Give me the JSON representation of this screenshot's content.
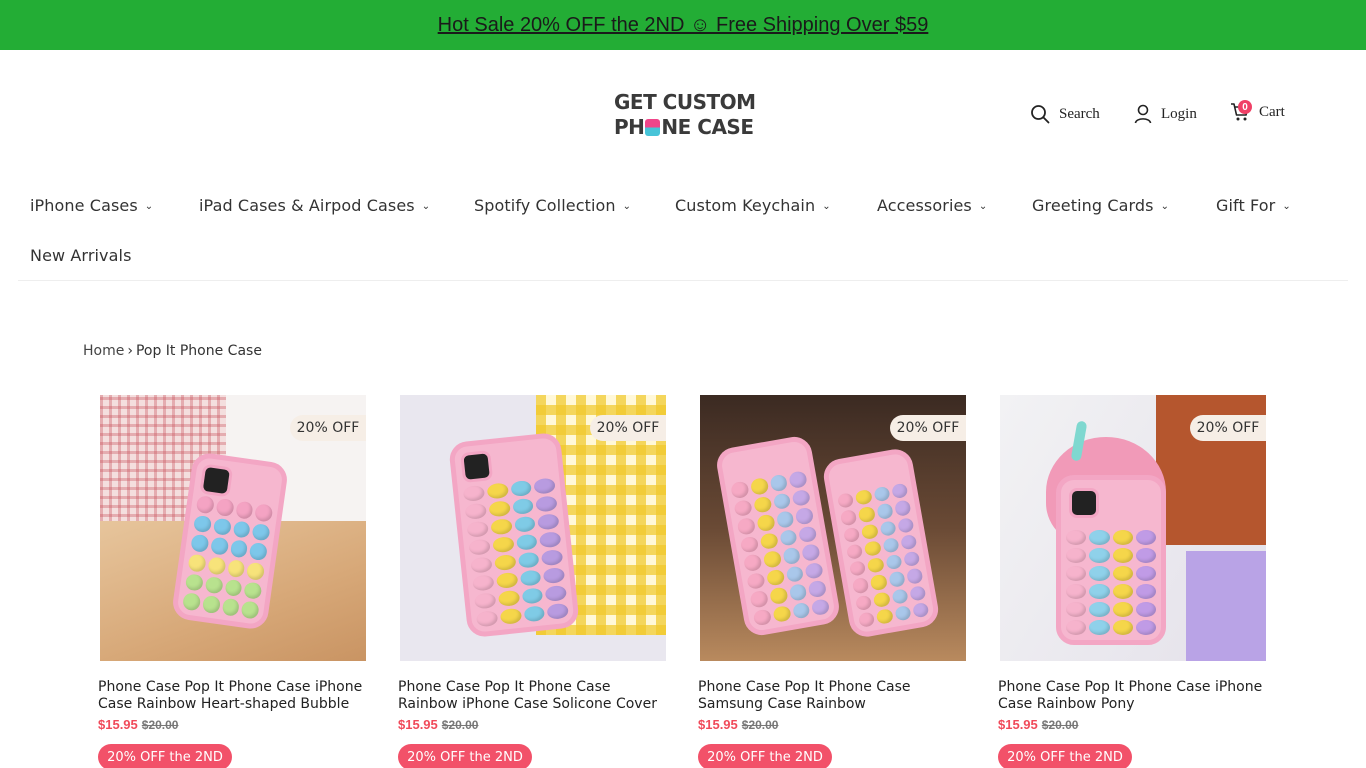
{
  "announcement": {
    "text": "Hot Sale 20% OFF the 2ND ☺ Free Shipping Over $59"
  },
  "logo": {
    "line1": "GET CUSTOM",
    "line2_a": "PH",
    "line2_b": "NE CASE"
  },
  "header": {
    "search_label": "Search",
    "login_label": "Login",
    "cart_label": "Cart",
    "cart_count": "0"
  },
  "nav": {
    "items": [
      {
        "label": "iPhone Cases",
        "has_dropdown": true
      },
      {
        "label": "iPad Cases & Airpod Cases",
        "has_dropdown": true
      },
      {
        "label": "Spotify Collection",
        "has_dropdown": true
      },
      {
        "label": "Custom Keychain",
        "has_dropdown": true
      },
      {
        "label": "Accessories",
        "has_dropdown": true
      },
      {
        "label": "Greeting Cards",
        "has_dropdown": true
      },
      {
        "label": "Gift For",
        "has_dropdown": true
      },
      {
        "label": "New Arrivals",
        "has_dropdown": false
      }
    ]
  },
  "breadcrumb": {
    "home": "Home",
    "separator": "›",
    "current": "Pop It Phone Case"
  },
  "products": [
    {
      "title": "Phone Case Pop It Phone Case iPhone Case Rainbow Heart-shaped Bubble",
      "price": "$15.95",
      "compare_price": "$20.00",
      "badge": "20% OFF",
      "promo": "20% OFF the 2ND"
    },
    {
      "title": "Phone Case Pop It Phone Case Rainbow iPhone Case Solicone Cover",
      "price": "$15.95",
      "compare_price": "$20.00",
      "badge": "20% OFF",
      "promo": "20% OFF the 2ND"
    },
    {
      "title": "Phone Case Pop It Phone Case Samsung Case Rainbow",
      "price": "$15.95",
      "compare_price": "$20.00",
      "badge": "20% OFF",
      "promo": "20% OFF the 2ND"
    },
    {
      "title": "Phone Case Pop It Phone Case iPhone Case Rainbow Pony",
      "price": "$15.95",
      "compare_price": "$20.00",
      "badge": "20% OFF",
      "promo": "20% OFF the 2ND"
    }
  ],
  "colors": {
    "announcement_bg": "#23ad35",
    "price": "#f04a5a",
    "promo_bg": "#f25169",
    "badge_bg": "#f6eee6",
    "cart_badge": "#f04066"
  },
  "icons": {
    "search": "search-icon",
    "login": "user-icon",
    "cart": "cart-icon",
    "dropdown": "chevron-down-icon"
  }
}
